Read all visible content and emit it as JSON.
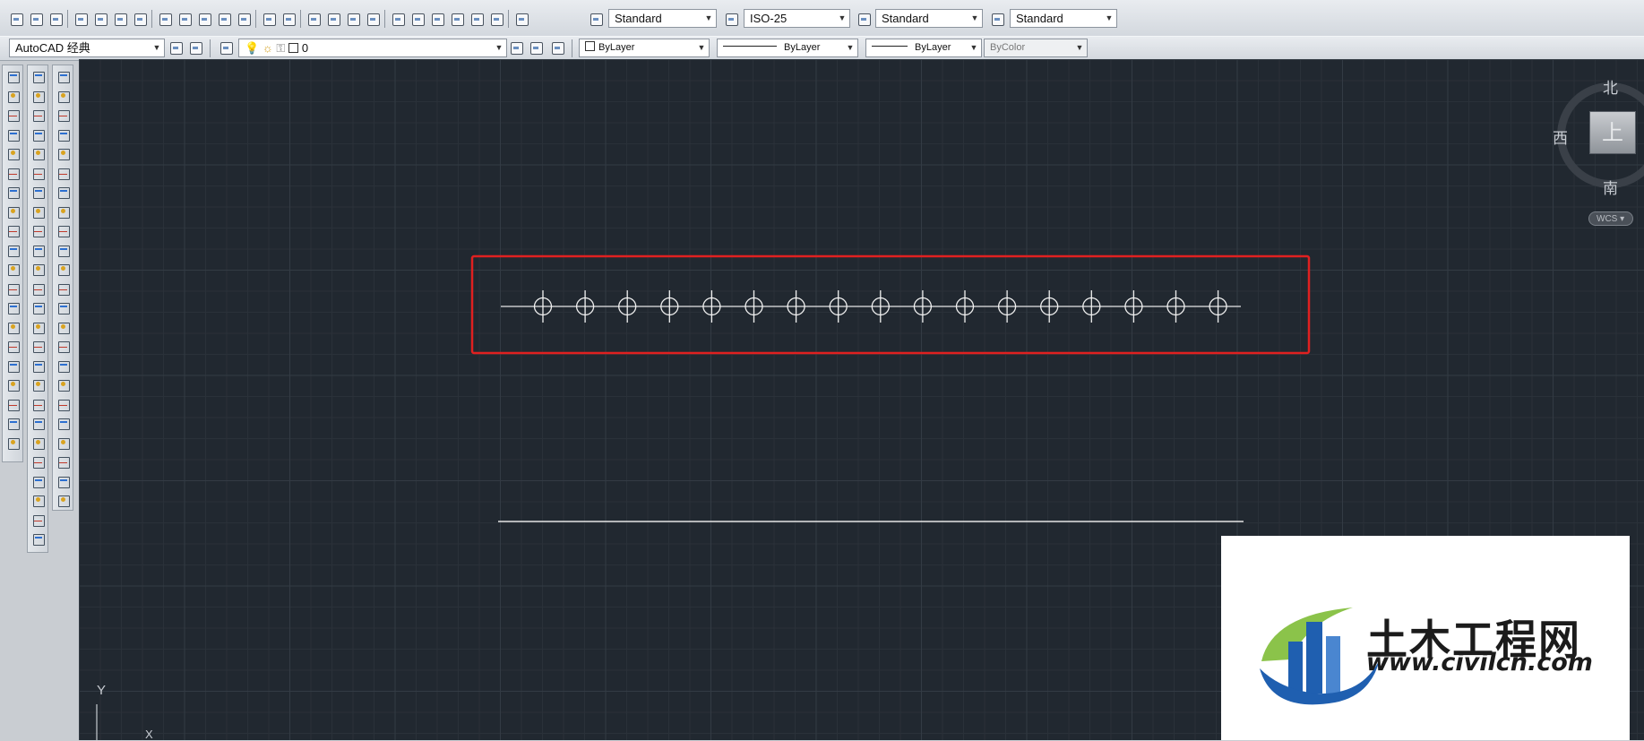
{
  "toolbar": {
    "text_style": "Standard",
    "dim_style": "ISO-25",
    "table_style": "Standard",
    "multileader_style": "Standard",
    "workspace": "AutoCAD 经典",
    "layer": "0",
    "color": "ByLayer",
    "linetype": "ByLayer",
    "lineweight": "ByLayer",
    "plot_style": "ByColor"
  },
  "viewcube": {
    "north": "北",
    "south": "南",
    "west": "西",
    "face": "上",
    "wcs": "WCS"
  },
  "ucs": {
    "y": "Y",
    "x": "X"
  },
  "watermark": {
    "title": "土木工程网",
    "url": "www.civilcn.com"
  },
  "drawing": {
    "circle_count": 17,
    "highlight_color": "#e02020"
  }
}
